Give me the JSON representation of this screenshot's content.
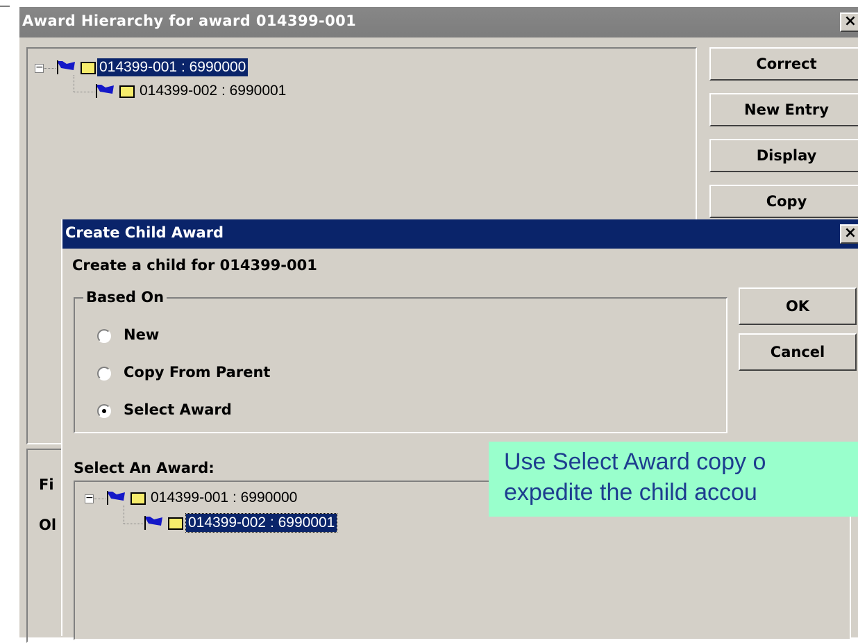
{
  "outer_window": {
    "title": "Award Hierarchy for award 014399-001",
    "close_label": "×",
    "tree": [
      {
        "label": "014399-001 : 6990000",
        "expander": "−",
        "selected": true
      },
      {
        "label": "014399-002 : 6990001",
        "selected": false
      }
    ],
    "buttons": [
      "Correct",
      "New Entry",
      "Display",
      "Copy"
    ],
    "partial_labels": [
      "Fi",
      "Ol"
    ]
  },
  "dialog": {
    "title": "Create Child Award",
    "close_label": "×",
    "heading": "Create a child for 014399-001",
    "group_label": "Based On",
    "options": [
      {
        "label": "New",
        "checked": false
      },
      {
        "label": "Copy From Parent",
        "checked": false
      },
      {
        "label": "Select Award",
        "checked": true
      }
    ],
    "ok_label": "OK",
    "cancel_label": "Cancel",
    "select_label": "Select An Award:",
    "tree": [
      {
        "label": "014399-001 : 6990000",
        "expander": "−",
        "selected": false
      },
      {
        "label": "014399-002 : 6990001",
        "selected": true
      }
    ]
  },
  "callout": {
    "line1": "Use Select Award copy o",
    "line2": "expedite the child accou",
    "background": "#99ffcc",
    "text_color": "#1d3d8f"
  },
  "icons": {
    "node_flag": "flag-icon",
    "node_folder": "folder-icon"
  }
}
